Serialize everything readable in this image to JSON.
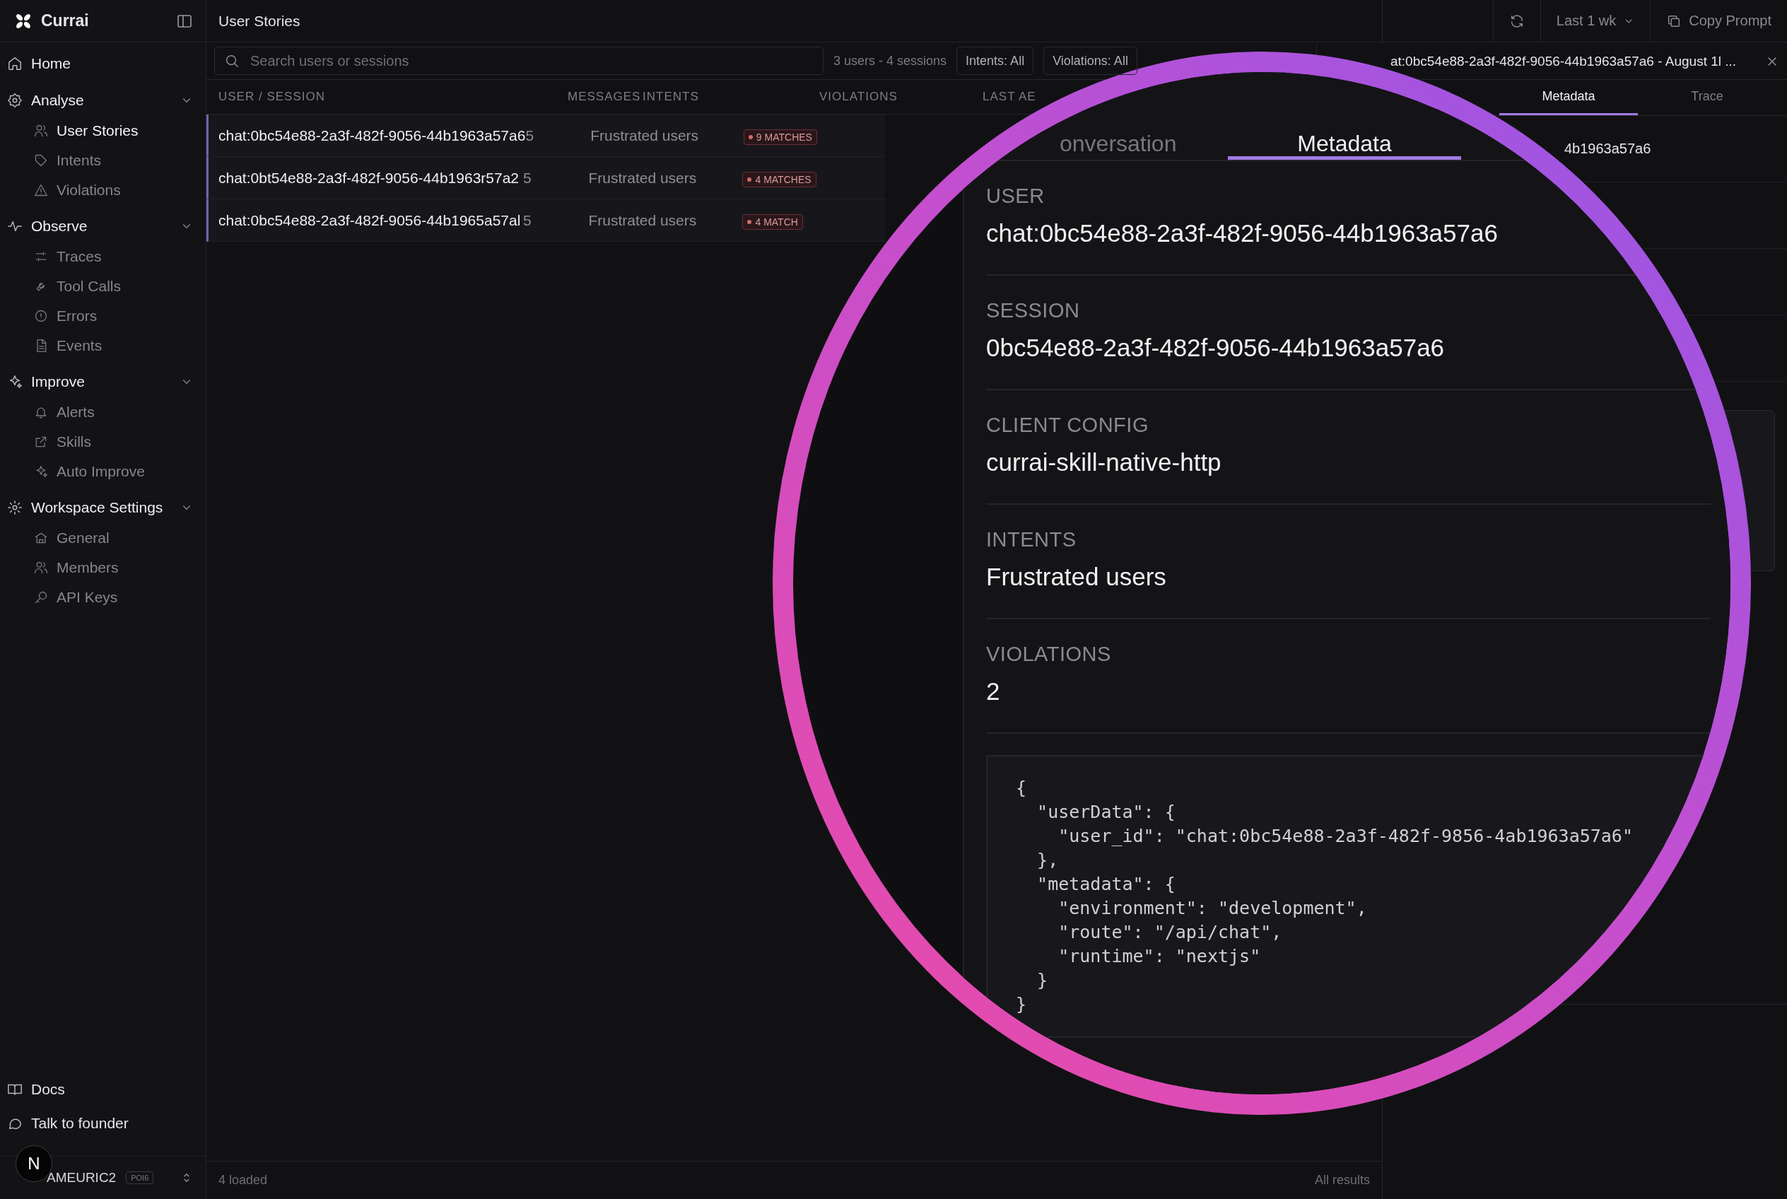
{
  "sidebar": {
    "brand": "Currai",
    "nav": [
      {
        "label": "Home",
        "kind": "link"
      },
      {
        "label": "Analyse",
        "kind": "group",
        "expanded": true,
        "children": [
          {
            "label": "User Stories",
            "selected": true
          },
          {
            "label": "Intents",
            "selected": false
          },
          {
            "label": "Violations",
            "selected": false
          }
        ]
      },
      {
        "label": "Observe",
        "kind": "group",
        "expanded": true,
        "children": [
          {
            "label": "Traces",
            "selected": false
          },
          {
            "label": "Tool Calls",
            "selected": false
          },
          {
            "label": "Errors",
            "selected": false
          },
          {
            "label": "Events",
            "selected": false
          }
        ]
      },
      {
        "label": "Improve",
        "kind": "group",
        "expanded": true,
        "children": [
          {
            "label": "Alerts",
            "selected": false
          },
          {
            "label": "Skills",
            "selected": false
          },
          {
            "label": "Auto Improve",
            "selected": false
          }
        ]
      },
      {
        "label": "Workspace Settings",
        "kind": "group",
        "expanded": true,
        "children": [
          {
            "label": "General",
            "selected": false
          },
          {
            "label": "Members",
            "selected": false
          },
          {
            "label": "API Keys",
            "selected": false
          }
        ]
      }
    ],
    "footer_links": [
      "Docs",
      "Talk to founder"
    ],
    "workspace": {
      "name": "AMEURIC2",
      "badge": "POI6"
    },
    "dev_indicator": "N"
  },
  "header": {
    "title": "User Stories",
    "range": "Last 1 wk",
    "copy_button": "Copy Prompt"
  },
  "toolbar": {
    "search_placeholder": "Search users or sessions",
    "summary": "3 users - 4 sessions",
    "filters": [
      "Intents: All",
      "Violations: All"
    ]
  },
  "table": {
    "columns": [
      "USER / SESSION",
      "MESSAGES",
      "INTENTS",
      "VIOLATIONS",
      "LAST AE"
    ],
    "rows": [
      {
        "user": "chat:0bc54e88-2a3f-482f-9056-44b1963a57a6",
        "messages": "5",
        "intents": "Frustrated users",
        "violations": "9 MATCHES"
      },
      {
        "user": "chat:0bt54e88-2a3f-482f-9056-44b1963r57a2",
        "messages": "5",
        "intents": "Frustrated users",
        "violations": "4 MATCHES"
      },
      {
        "user": "chat:0bc54e88-2a3f-482f-9056-44b1965a57al",
        "messages": "5",
        "intents": "Frustrated users",
        "violations": "4 MATCH"
      }
    ]
  },
  "footer": {
    "count": "4 loaded",
    "scope": "All results"
  },
  "detail_panel": {
    "title": "at:0bc54e88-2a3f-482f-9056-44b1963a57a6 - August 1l ...",
    "tabs": [
      {
        "label": "Metadata",
        "selected": true
      },
      {
        "label": "Trace",
        "selected": false
      }
    ],
    "visible_value": "4b1963a57a6"
  },
  "magnifier": {
    "tabs": [
      {
        "label": "onversation",
        "selected": false
      },
      {
        "label": "Metadata",
        "selected": true
      }
    ],
    "fields": [
      {
        "label": "USER",
        "value": "chat:0bc54e88-2a3f-482f-9056-44b1963a57a6"
      },
      {
        "label": "SESSION",
        "value": "0bc54e88-2a3f-482f-9056-44b1963a57a6"
      },
      {
        "label": "CLIENT CONFIG",
        "value": "currai-skill-native-http"
      },
      {
        "label": "INTENTS",
        "value": "Frustrated users"
      },
      {
        "label": "VIOLATIONS",
        "value": "2"
      }
    ],
    "code": "{\n  \"userData\": {\n    \"user_id\": \"chat:0bc54e88-2a3f-482f-9856-4ab1963a57a6\"\n  },\n  \"metadata\": {\n    \"environment\": \"development\",\n    \"route\": \"/api/chat\",\n    \"runtime\": \"nextjs\"\n  }\n}"
  }
}
